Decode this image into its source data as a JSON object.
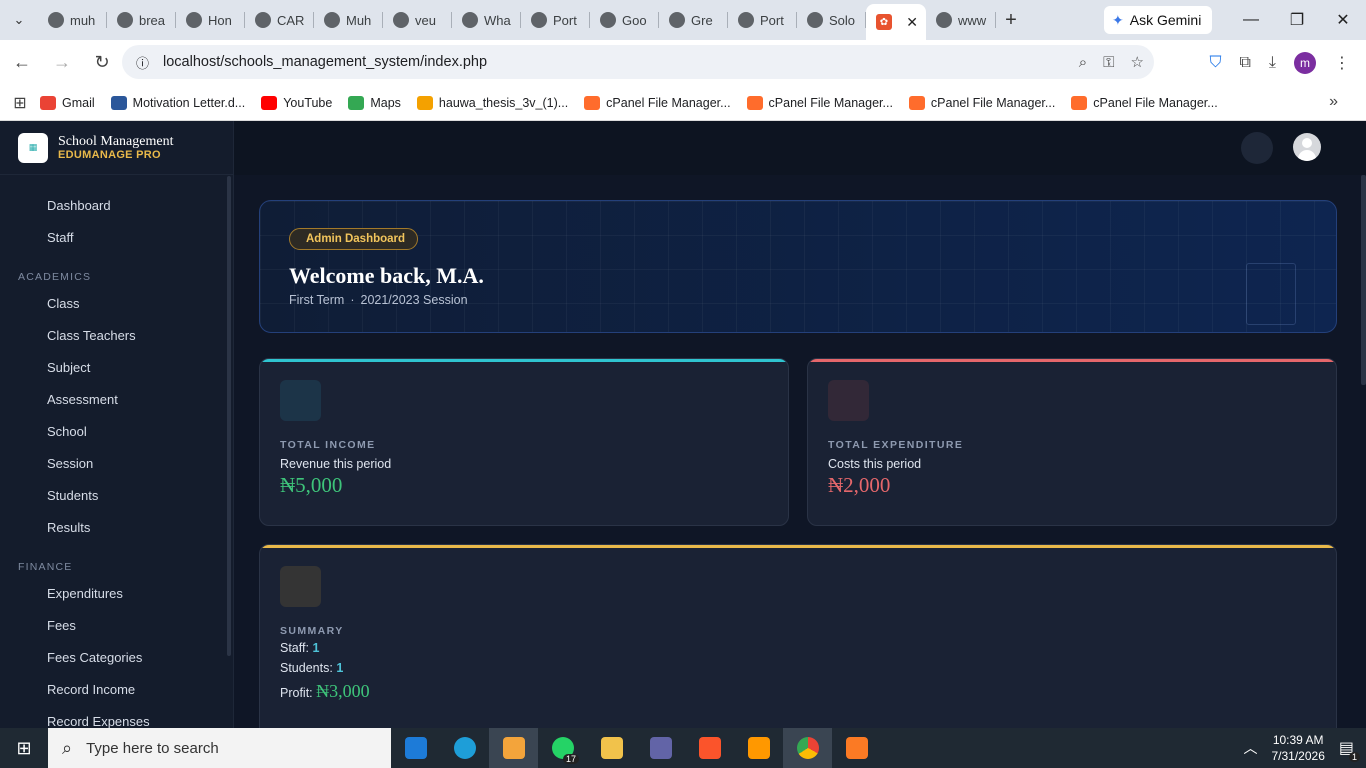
{
  "browser": {
    "tabs": [
      {
        "title": "muh",
        "icon": "globe-icon"
      },
      {
        "title": "brea",
        "icon": "globe-icon"
      },
      {
        "title": "Hon",
        "icon": "globe-icon"
      },
      {
        "title": "CAR",
        "icon": "globe-icon"
      },
      {
        "title": "Muh",
        "icon": "github-icon"
      },
      {
        "title": "veu",
        "icon": "globe-icon"
      },
      {
        "title": "Wha",
        "icon": "whatsapp-icon"
      },
      {
        "title": "Port",
        "icon": "gemini-icon"
      },
      {
        "title": "Goo",
        "icon": "google-icon"
      },
      {
        "title": "Gre",
        "icon": "claude-icon"
      },
      {
        "title": "Port",
        "icon": "globe-icon"
      },
      {
        "title": "Solo",
        "icon": "openai-icon"
      }
    ],
    "active_tab_icon": "xampp-icon",
    "trailing_tab": "www",
    "ask_gemini": "Ask Gemini",
    "url": "localhost/schools_management_system/index.php",
    "bookmarks": [
      {
        "label": "Gmail",
        "color": "#ea4335"
      },
      {
        "label": "Motivation Letter.d...",
        "color": "#2b579a"
      },
      {
        "label": "YouTube",
        "color": "#ff0000"
      },
      {
        "label": "Maps",
        "color": "#34a853"
      },
      {
        "label": "hauwa_thesis_3v_(1)...",
        "color": "#f4a100"
      },
      {
        "label": "cPanel File Manager...",
        "color": "#ff6c2c"
      },
      {
        "label": "cPanel File Manager...",
        "color": "#ff6c2c"
      },
      {
        "label": "cPanel File Manager...",
        "color": "#ff6c2c"
      },
      {
        "label": "cPanel File Manager...",
        "color": "#ff6c2c"
      }
    ]
  },
  "app": {
    "brand_title": "School Management",
    "brand_sub": "EDUMANAGE PRO",
    "nav_top": [
      "Dashboard",
      "Staff"
    ],
    "section_academics": "ACADEMICS",
    "nav_academics": [
      "Class",
      "Class Teachers",
      "Subject",
      "Assessment",
      "School",
      "Session",
      "Students",
      "Results"
    ],
    "section_finance": "FINANCE",
    "nav_finance": [
      "Expenditures",
      "Fees",
      "Fees Categories",
      "Record Income",
      "Record Expenses"
    ]
  },
  "hero": {
    "badge": "Admin Dashboard",
    "welcome": "Welcome back, M.A.",
    "term": "First Term",
    "sep": "·",
    "session": "2021/2023 Session"
  },
  "income": {
    "label": "TOTAL INCOME",
    "sub": "Revenue this period",
    "value": "₦5,000",
    "accent": "#2fc4d0",
    "value_color": "#3ec47a"
  },
  "expenditure": {
    "label": "TOTAL EXPENDITURE",
    "sub": "Costs this period",
    "value": "₦2,000",
    "accent": "#e5676b",
    "value_color": "#e5676b"
  },
  "summary": {
    "label": "SUMMARY",
    "staff_label": "Staff:",
    "staff_value": "1",
    "students_label": "Students:",
    "students_value": "1",
    "profit_label": "Profit:",
    "profit_value": "₦3,000",
    "accent": "#e9b94a"
  },
  "taskbar": {
    "search_placeholder": "Type here to search",
    "time": "10:39 AM",
    "date": "7/31/2026",
    "whatsapp_count": "17",
    "notification_count": "1"
  }
}
